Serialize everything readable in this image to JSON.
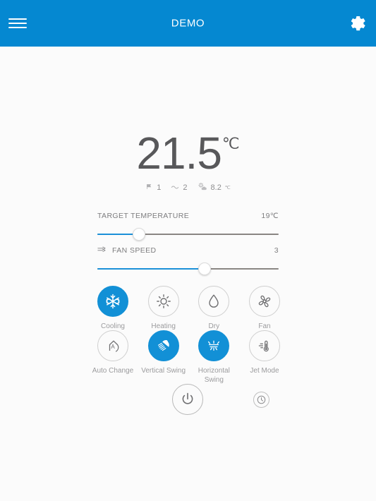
{
  "header": {
    "title": "DEMO",
    "menu_icon": "hamburger-menu-icon",
    "settings_icon": "gear-icon",
    "background_color": "#0588d1"
  },
  "theme": {
    "accent": "#1290d6",
    "page_background": "#fbfbfb",
    "text_muted": "#9b9b9d",
    "track_active": "#1b90d8",
    "track_inactive": "#8a8683"
  },
  "temperature": {
    "value": "21.5",
    "unit": "℃"
  },
  "status": [
    {
      "icon": "flag-indoor-icon",
      "value": "1"
    },
    {
      "icon": "wave-airflow-icon",
      "value": "2"
    },
    {
      "icon": "sun-cloud-weather-icon",
      "value": "8.2",
      "unit": "℃"
    }
  ],
  "sliders": [
    {
      "label": "TARGET TEMPERATURE",
      "value": "19℃",
      "icon": null,
      "fill_percent": 23
    },
    {
      "label": "FAN SPEED",
      "value": "3",
      "icon": "airflow-arrow-icon",
      "fill_percent": 59
    }
  ],
  "modes": {
    "row1": [
      {
        "label": "Cooling",
        "icon": "snowflake-icon",
        "active": true
      },
      {
        "label": "Heating",
        "icon": "sun-icon",
        "active": false
      },
      {
        "label": "Dry",
        "icon": "water-drop-icon",
        "active": false
      },
      {
        "label": "Fan",
        "icon": "fan-blades-icon",
        "active": false
      }
    ],
    "row2": [
      {
        "label": "Auto Change",
        "icon": "auto-change-icon",
        "active": false
      },
      {
        "label": "Vertical Swing",
        "icon": "vertical-swing-icon",
        "active": true
      },
      {
        "label": "Horizontal Swing",
        "icon": "horizontal-swing-icon",
        "active": true
      },
      {
        "label": "Jet Mode",
        "icon": "jet-mode-icon",
        "active": false
      }
    ]
  },
  "controls": {
    "power": {
      "icon": "power-icon",
      "label": "Power"
    },
    "timer": {
      "icon": "clock-timer-icon",
      "label": "Timer"
    }
  }
}
